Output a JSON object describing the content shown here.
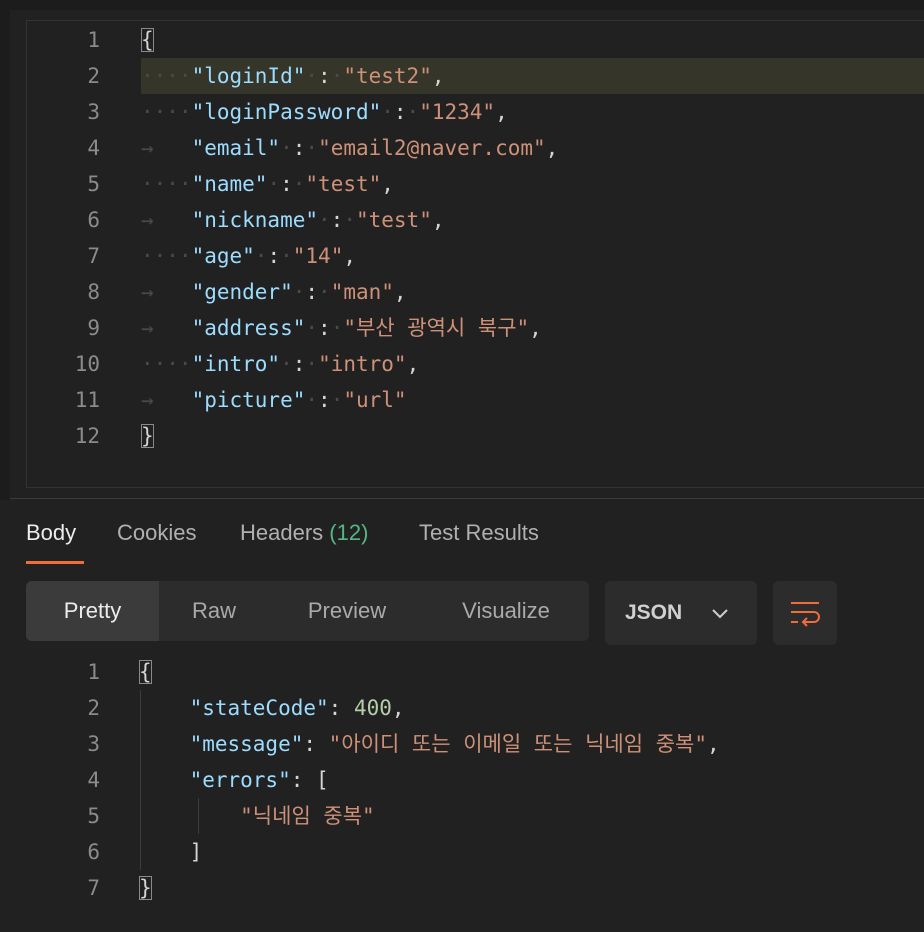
{
  "request_body": {
    "lines": [
      {
        "n": "1",
        "parts": [
          {
            "t": "{",
            "c": "p",
            "box": true
          }
        ]
      },
      {
        "n": "2",
        "ws": "····",
        "parts": [
          {
            "t": "\"loginId\"",
            "c": "k"
          },
          {
            "t": "·",
            "c": "ws"
          },
          {
            "t": ":",
            "c": "p"
          },
          {
            "t": "·",
            "c": "ws"
          },
          {
            "t": "\"test2\"",
            "c": "s"
          },
          {
            "t": ",",
            "c": "p"
          }
        ]
      },
      {
        "n": "3",
        "ws": "····",
        "parts": [
          {
            "t": "\"loginPassword\"",
            "c": "k"
          },
          {
            "t": "·",
            "c": "ws"
          },
          {
            "t": ":",
            "c": "p"
          },
          {
            "t": "·",
            "c": "ws"
          },
          {
            "t": "\"1234\"",
            "c": "s"
          },
          {
            "t": ",",
            "c": "p"
          }
        ]
      },
      {
        "n": "4",
        "ws": "→   ",
        "parts": [
          {
            "t": "\"email\"",
            "c": "k"
          },
          {
            "t": "·",
            "c": "ws"
          },
          {
            "t": ":",
            "c": "p"
          },
          {
            "t": "·",
            "c": "ws"
          },
          {
            "t": "\"email2@naver.com\"",
            "c": "s"
          },
          {
            "t": ",",
            "c": "p"
          }
        ]
      },
      {
        "n": "5",
        "ws": "····",
        "parts": [
          {
            "t": "\"name\"",
            "c": "k"
          },
          {
            "t": "·",
            "c": "ws"
          },
          {
            "t": ":",
            "c": "p"
          },
          {
            "t": "·",
            "c": "ws"
          },
          {
            "t": "\"test\"",
            "c": "s"
          },
          {
            "t": ",",
            "c": "p"
          }
        ]
      },
      {
        "n": "6",
        "ws": "→   ",
        "parts": [
          {
            "t": "\"nickname\"",
            "c": "k"
          },
          {
            "t": "·",
            "c": "ws"
          },
          {
            "t": ":",
            "c": "p"
          },
          {
            "t": "·",
            "c": "ws"
          },
          {
            "t": "\"test\"",
            "c": "s"
          },
          {
            "t": ",",
            "c": "p"
          }
        ]
      },
      {
        "n": "7",
        "ws": "····",
        "parts": [
          {
            "t": "\"age\"",
            "c": "k"
          },
          {
            "t": "·",
            "c": "ws"
          },
          {
            "t": ":",
            "c": "p"
          },
          {
            "t": "·",
            "c": "ws"
          },
          {
            "t": "\"14\"",
            "c": "s"
          },
          {
            "t": ",",
            "c": "p"
          }
        ]
      },
      {
        "n": "8",
        "ws": "→   ",
        "parts": [
          {
            "t": "\"gender\"",
            "c": "k"
          },
          {
            "t": "·",
            "c": "ws"
          },
          {
            "t": ":",
            "c": "p"
          },
          {
            "t": "·",
            "c": "ws"
          },
          {
            "t": "\"man\"",
            "c": "s"
          },
          {
            "t": ",",
            "c": "p"
          }
        ]
      },
      {
        "n": "9",
        "ws": "→   ",
        "parts": [
          {
            "t": "\"address\"",
            "c": "k"
          },
          {
            "t": "·",
            "c": "ws"
          },
          {
            "t": ":",
            "c": "p"
          },
          {
            "t": "·",
            "c": "ws"
          },
          {
            "t": "\"부산 광역시 북구\"",
            "c": "s"
          },
          {
            "t": ",",
            "c": "p"
          }
        ]
      },
      {
        "n": "10",
        "ws": "····",
        "parts": [
          {
            "t": "\"intro\"",
            "c": "k"
          },
          {
            "t": "·",
            "c": "ws"
          },
          {
            "t": ":",
            "c": "p"
          },
          {
            "t": "·",
            "c": "ws"
          },
          {
            "t": "\"intro\"",
            "c": "s"
          },
          {
            "t": ",",
            "c": "p"
          }
        ]
      },
      {
        "n": "11",
        "ws": "→   ",
        "parts": [
          {
            "t": "\"picture\"",
            "c": "k"
          },
          {
            "t": "·",
            "c": "ws"
          },
          {
            "t": ":",
            "c": "p"
          },
          {
            "t": "·",
            "c": "ws"
          },
          {
            "t": "\"url\"",
            "c": "s"
          }
        ]
      },
      {
        "n": "12",
        "parts": [
          {
            "t": "}",
            "c": "p",
            "box": true
          }
        ]
      }
    ]
  },
  "response_tabs": {
    "body": "Body",
    "cookies": "Cookies",
    "headers": "Headers",
    "headers_count": "(12)",
    "test_results": "Test Results"
  },
  "view_modes": {
    "pretty": "Pretty",
    "raw": "Raw",
    "preview": "Preview",
    "visualize": "Visualize"
  },
  "format_select": {
    "selected": "JSON"
  },
  "icons": {
    "format_chevron": "chevron-down-icon",
    "wrap": "wrap-lines-icon"
  },
  "colors": {
    "accent": "#f26b3a",
    "key": "#9cdcfe",
    "string": "#ce9178",
    "number": "#b5cea8",
    "count": "#55b685"
  },
  "response_body": {
    "lines": [
      {
        "n": "1",
        "parts": [
          {
            "t": "{",
            "c": "p",
            "box": true
          }
        ]
      },
      {
        "n": "2",
        "ws": "    ",
        "parts": [
          {
            "t": "\"stateCode\"",
            "c": "k"
          },
          {
            "t": ": ",
            "c": "p"
          },
          {
            "t": "400",
            "c": "n"
          },
          {
            "t": ",",
            "c": "p"
          }
        ]
      },
      {
        "n": "3",
        "ws": "    ",
        "parts": [
          {
            "t": "\"message\"",
            "c": "k"
          },
          {
            "t": ": ",
            "c": "p"
          },
          {
            "t": "\"아이디 또는 이메일 또는 닉네임 중복\"",
            "c": "s"
          },
          {
            "t": ",",
            "c": "p"
          }
        ]
      },
      {
        "n": "4",
        "ws": "    ",
        "parts": [
          {
            "t": "\"errors\"",
            "c": "k"
          },
          {
            "t": ": [",
            "c": "p"
          }
        ]
      },
      {
        "n": "5",
        "ws": "        ",
        "parts": [
          {
            "t": "\"닉네임 중복\"",
            "c": "s"
          }
        ]
      },
      {
        "n": "6",
        "ws": "    ",
        "parts": [
          {
            "t": "]",
            "c": "p"
          }
        ]
      },
      {
        "n": "7",
        "parts": [
          {
            "t": "}",
            "c": "p",
            "box": true
          }
        ]
      }
    ]
  }
}
